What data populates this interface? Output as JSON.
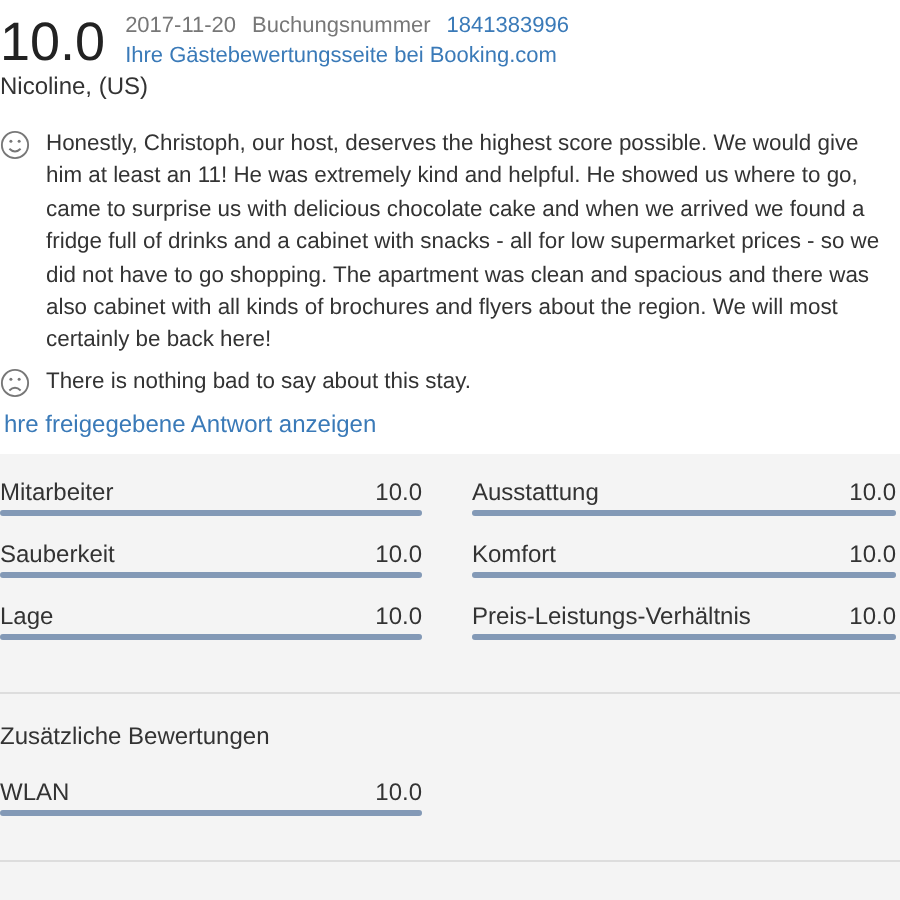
{
  "review": {
    "score": "10.0",
    "date": "2017-11-20",
    "booking_label": "Buchungsnummer",
    "booking_number": "1841383996",
    "guest_page_link": "Ihre Gästebewertungsseite bei Booking.com",
    "reviewer": "Nicoline, (US)",
    "comments": [
      {
        "kind": "positive",
        "text": "Honestly, Christoph, our host, deserves the highest score possible. We would give him at least an 11! He was extremely kind and helpful. He showed us where to go, came to surprise us with delicious chocolate cake and when we arrived we found a fridge full of drinks and a cabinet with snacks - all for low supermarket prices - so we did not have to go shopping. The apartment was clean and spacious and there was also cabinet with all kinds of brochures and flyers about the region. We will most certainly be back here!"
      },
      {
        "kind": "negative",
        "text": "There is nothing bad to say about this stay."
      }
    ],
    "response_link": "hre freigegebene Antwort anzeigen"
  },
  "ratings": [
    {
      "label": "Mitarbeiter",
      "value": "10.0",
      "level": 1
    },
    {
      "label": "Ausstattung",
      "value": "10.0",
      "level": 1
    },
    {
      "label": "Sauberkeit",
      "value": "10.0",
      "level": 1
    },
    {
      "label": "Komfort",
      "value": "10.0",
      "level": 1
    },
    {
      "label": "Lage",
      "value": "10.0",
      "level": 1
    },
    {
      "label": "Preis-Leistungs-Verhältnis",
      "value": "10.0",
      "level": 1
    }
  ],
  "additional": {
    "title": "Zusätzliche Bewertungen",
    "ratings": [
      {
        "label": "WLAN",
        "value": "10.0",
        "level": 1
      }
    ]
  }
}
